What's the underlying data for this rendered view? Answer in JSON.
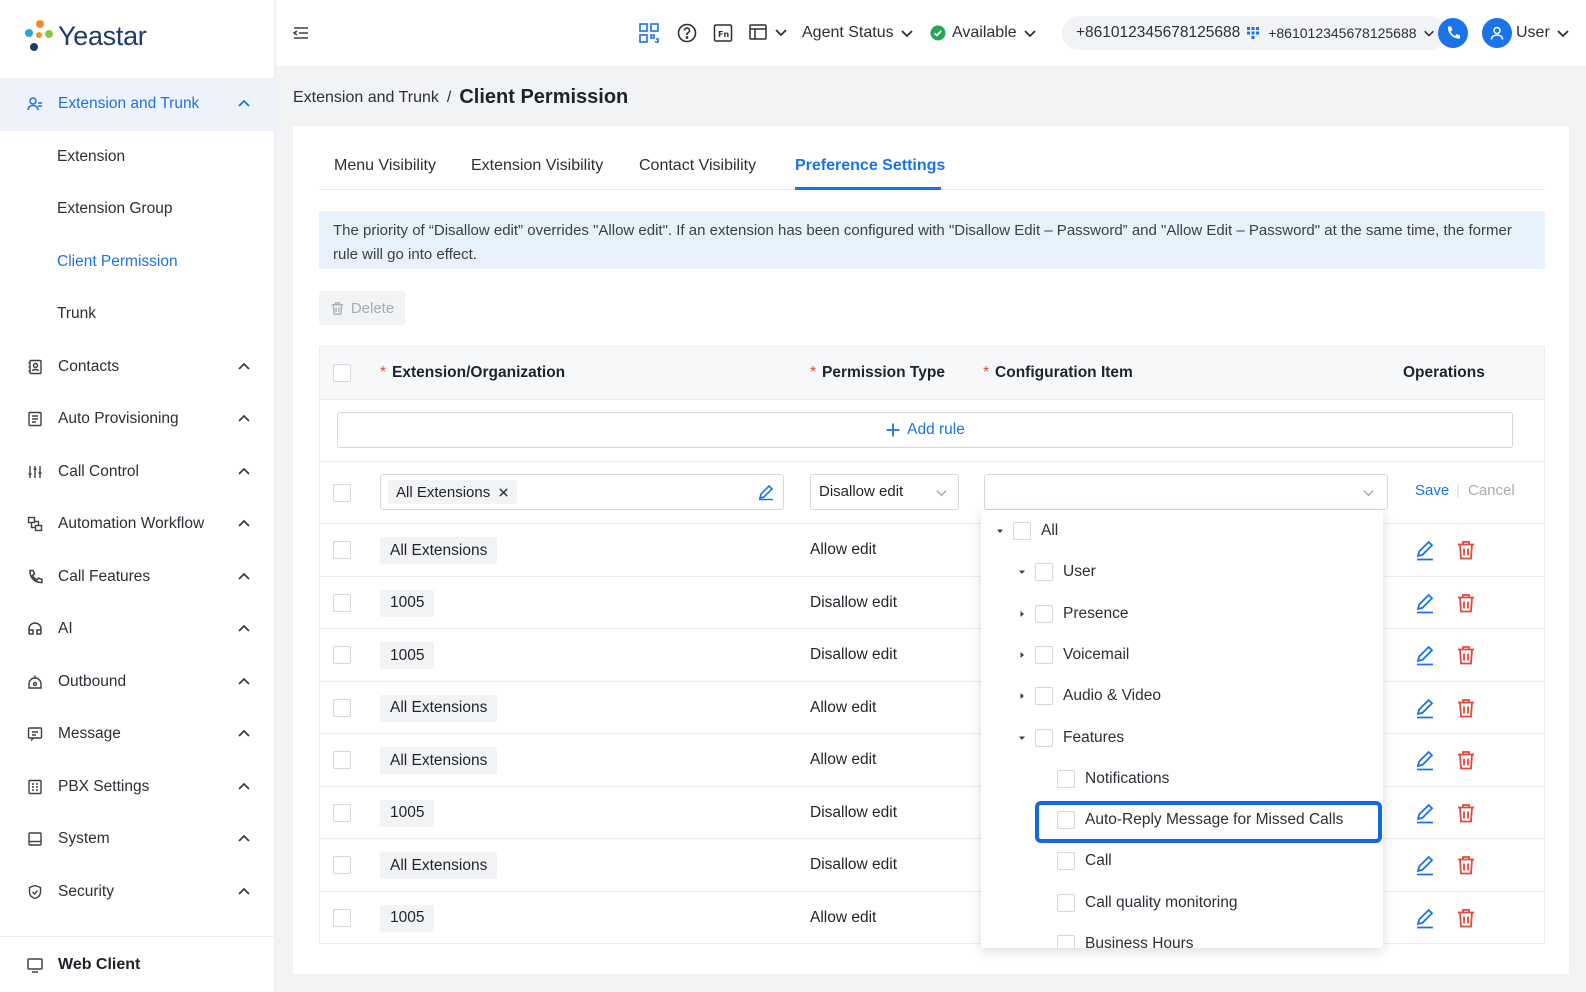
{
  "app": {
    "logo_text": "Yeastar"
  },
  "header": {
    "agent_status_label": "Agent Status",
    "available_label": "Available",
    "phone_primary": "+861012345678125688",
    "phone_secondary": "+861012345678125688",
    "user_label": "User",
    "colors": {
      "accent": "#1a73e8",
      "available": "#22a855"
    }
  },
  "sidebar": {
    "items": [
      {
        "label": "Extension and Trunk",
        "icon": "users-icon",
        "expanded": true
      },
      {
        "label": "Extension"
      },
      {
        "label": "Extension Group"
      },
      {
        "label": "Client Permission",
        "current": true
      },
      {
        "label": "Trunk"
      },
      {
        "label": "Contacts",
        "icon": "contacts-icon"
      },
      {
        "label": "Auto Provisioning",
        "icon": "provisioning-icon"
      },
      {
        "label": "Call Control",
        "icon": "sliders-icon"
      },
      {
        "label": "Automation Workflow",
        "icon": "workflow-icon"
      },
      {
        "label": "Call Features",
        "icon": "phone-icon"
      },
      {
        "label": "AI",
        "icon": "ai-icon"
      },
      {
        "label": "Outbound",
        "icon": "outbound-icon"
      },
      {
        "label": "Message",
        "icon": "message-icon"
      },
      {
        "label": "PBX Settings",
        "icon": "pbx-icon"
      },
      {
        "label": "System",
        "icon": "system-icon"
      },
      {
        "label": "Security",
        "icon": "shield-icon"
      }
    ],
    "web_client_label": "Web Client"
  },
  "breadcrumb": {
    "parent": "Extension and Trunk",
    "separator": "/",
    "current": "Client Permission"
  },
  "tabs": [
    "Menu Visibility",
    "Extension Visibility",
    "Contact Visibility",
    "Preference Settings"
  ],
  "notice": "The priority of “Disallow edit” overrides \"Allow edit\". If an extension has been configured with \"Disallow Edit – Password” and \"Allow Edit – Password\" at the same time, the former rule will go into effect.",
  "toolbar": {
    "delete_label": "Delete"
  },
  "table": {
    "columns": [
      "Extension/Organization",
      "Permission Type",
      "Configuration Item",
      "Operations"
    ],
    "add_rule_label": "Add rule",
    "edit_row": {
      "extension_tag": "All Extensions",
      "permission": "Disallow edit",
      "save_label": "Save",
      "cancel_label": "Cancel"
    },
    "rows": [
      {
        "extension": "All Extensions",
        "permission": "Allow edit"
      },
      {
        "extension": "1005",
        "permission": "Disallow edit"
      },
      {
        "extension": "1005",
        "permission": "Disallow edit"
      },
      {
        "extension": "All Extensions",
        "permission": "Allow edit"
      },
      {
        "extension": "All Extensions",
        "permission": "Allow edit"
      },
      {
        "extension": "1005",
        "permission": "Disallow edit"
      },
      {
        "extension": "All Extensions",
        "permission": "Disallow edit"
      },
      {
        "extension": "1005",
        "permission": "Allow edit"
      }
    ]
  },
  "dropdown": {
    "nodes": [
      {
        "label": "All",
        "arrow": "down"
      },
      {
        "label": "User",
        "arrow": "down"
      },
      {
        "label": "Presence",
        "arrow": "right"
      },
      {
        "label": "Voicemail",
        "arrow": "right"
      },
      {
        "label": "Audio & Video",
        "arrow": "right"
      },
      {
        "label": "Features",
        "arrow": "down"
      },
      {
        "label": "Notifications"
      },
      {
        "label": "Auto-Reply Message for Missed Calls",
        "highlighted": true
      },
      {
        "label": "Call"
      },
      {
        "label": "Call quality monitoring"
      },
      {
        "label": "Business Hours"
      }
    ]
  }
}
